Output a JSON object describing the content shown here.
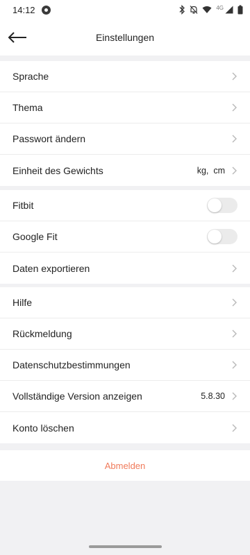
{
  "status_bar": {
    "time": "14:12",
    "network_label": "4G"
  },
  "header": {
    "title": "Einstellungen"
  },
  "section_general": {
    "items": [
      {
        "label": "Sprache"
      },
      {
        "label": "Thema"
      },
      {
        "label": "Passwort ändern"
      },
      {
        "label": "Einheit des Gewichts",
        "value": "kg,  cm"
      }
    ]
  },
  "section_connections": {
    "items": [
      {
        "label": "Fitbit",
        "toggle_on": false
      },
      {
        "label": "Google Fit",
        "toggle_on": false
      },
      {
        "label": "Daten exportieren"
      }
    ]
  },
  "section_support": {
    "items": [
      {
        "label": "Hilfe"
      },
      {
        "label": "Rückmeldung"
      },
      {
        "label": "Datenschutzbestimmungen"
      },
      {
        "label": "Vollständige Version anzeigen",
        "value": "5.8.30"
      },
      {
        "label": "Konto löschen"
      }
    ]
  },
  "logout": {
    "label": "Abmelden"
  },
  "colors": {
    "background": "#f1f1f3",
    "logout_accent": "#f07a5a",
    "chevron": "#b8b8b8",
    "toggle_off": "#ebebeb"
  }
}
